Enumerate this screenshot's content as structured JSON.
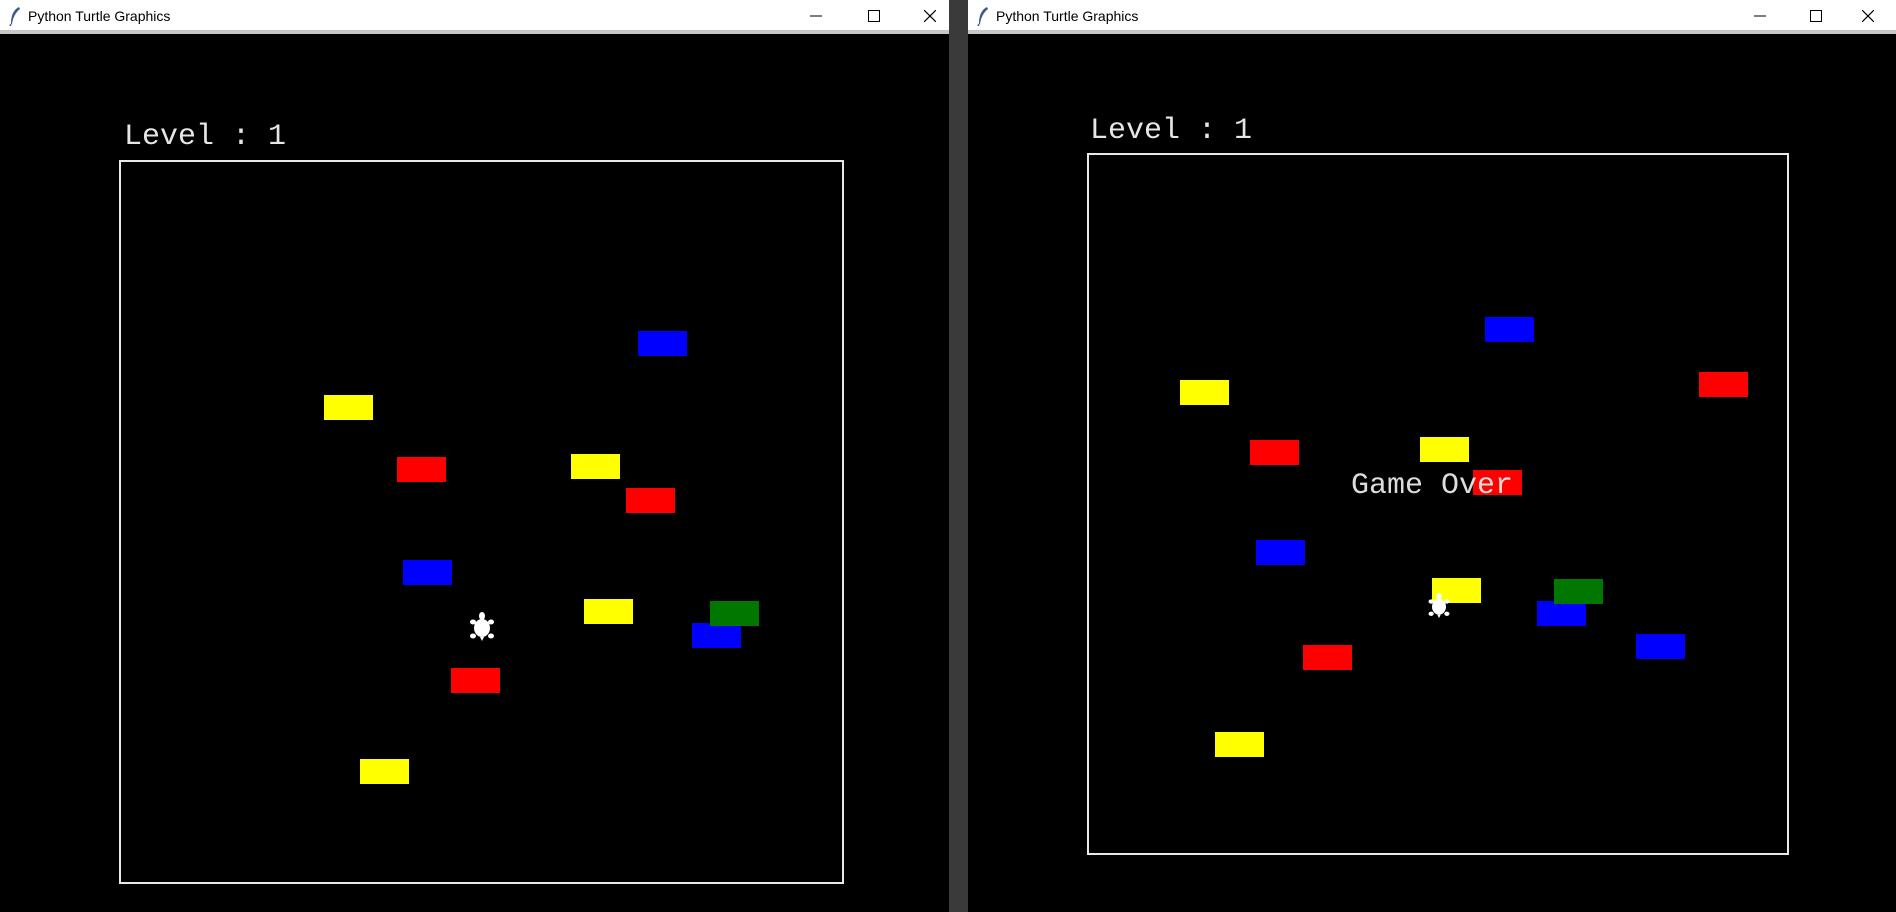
{
  "windows": [
    {
      "title": "Python Turtle Graphics",
      "level_text": "Level : 1",
      "game_over": null,
      "cars": [
        {
          "color": "blue"
        },
        {
          "color": "yellow"
        },
        {
          "color": "red"
        },
        {
          "color": "yellow"
        },
        {
          "color": "red"
        },
        {
          "color": "blue"
        },
        {
          "color": "yellow"
        },
        {
          "color": "blue"
        },
        {
          "color": "green"
        },
        {
          "color": "red"
        },
        {
          "color": "yellow"
        }
      ]
    },
    {
      "title": "Python Turtle Graphics",
      "level_text": "Level : 1",
      "game_over": "Game Over",
      "cars": [
        {
          "color": "blue"
        },
        {
          "color": "yellow"
        },
        {
          "color": "red"
        },
        {
          "color": "red"
        },
        {
          "color": "yellow"
        },
        {
          "color": "red"
        },
        {
          "color": "blue"
        },
        {
          "color": "yellow"
        },
        {
          "color": "blue"
        },
        {
          "color": "green"
        },
        {
          "color": "blue"
        },
        {
          "color": "red"
        },
        {
          "color": "yellow"
        }
      ]
    }
  ],
  "palette": {
    "blue": "#0000ff",
    "yellow": "#ffff00",
    "red": "#ff0000",
    "green": "#007800",
    "background": "#000000",
    "border": "#e8e8e8"
  },
  "icons": {
    "app": "feather-icon",
    "minimize": "minimize-icon",
    "maximize": "maximize-icon",
    "close": "close-icon",
    "player": "turtle-icon"
  }
}
